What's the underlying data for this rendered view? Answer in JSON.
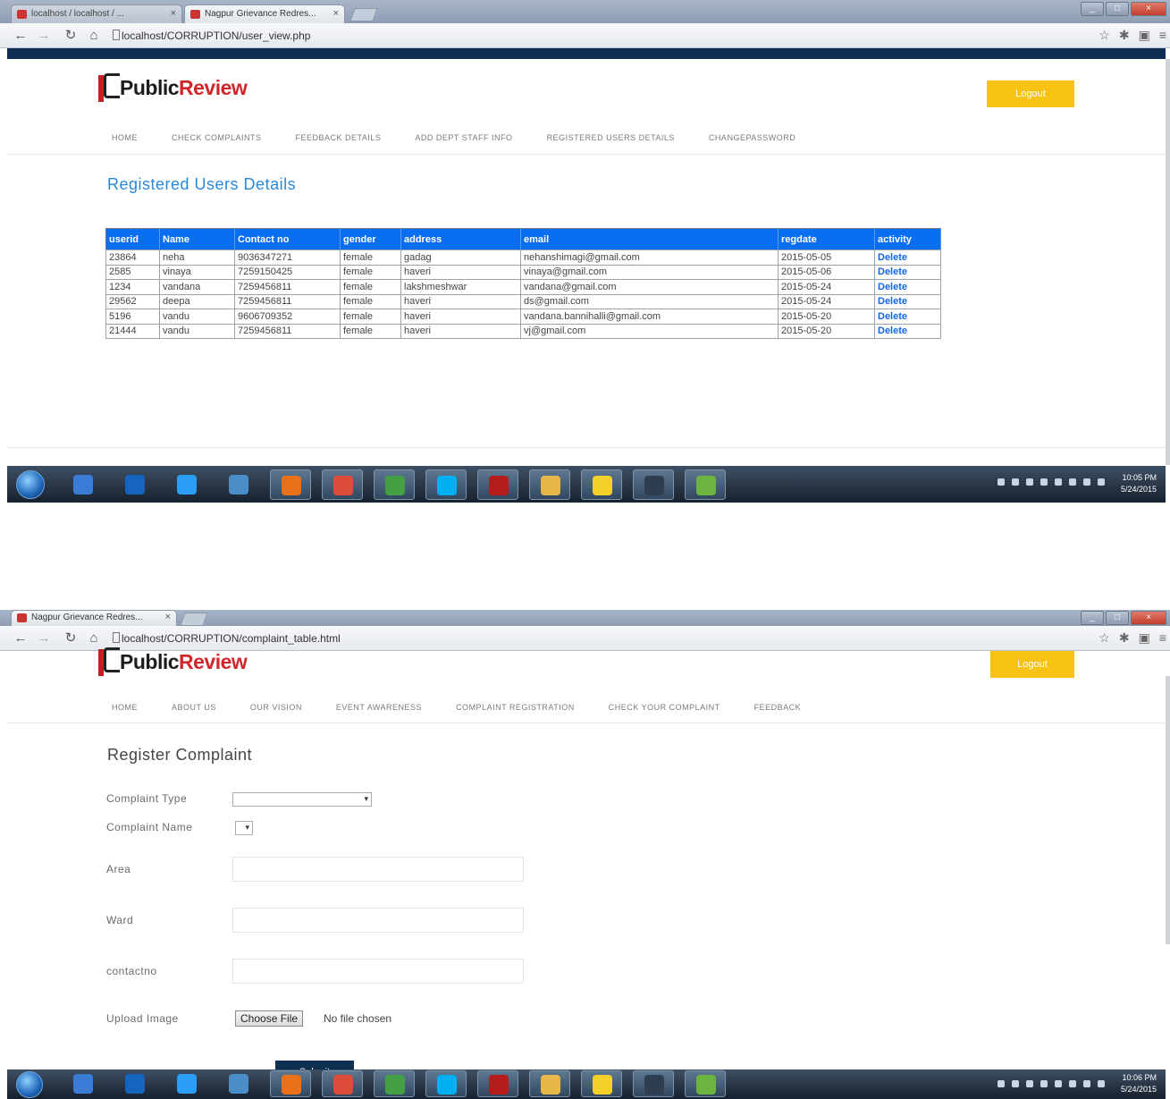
{
  "screenshot1": {
    "tabs": [
      {
        "label": "localhost / localhost / ..."
      },
      {
        "label": "Nagpur Grievance Redres..."
      }
    ],
    "url": "localhost/CORRUPTION/user_view.php",
    "logo": {
      "part1": "Public",
      "part2": "Review"
    },
    "logout_label": "Logout",
    "menu": [
      "HOME",
      "CHECK COMPLAINTS",
      "FEEDBACK DETAILS",
      "ADD DEPT STAFF INFO",
      "REGISTERED USERS DETAILS",
      "CHANGEPASSWORD"
    ],
    "heading": "Registered Users Details",
    "table": {
      "headers": [
        "userid",
        "Name",
        "Contact no",
        "gender",
        "address",
        "email",
        "regdate",
        "activity"
      ],
      "rows": [
        [
          "23864",
          "neha",
          "9036347271",
          "female",
          "gadag",
          "nehanshimagi@gmail.com",
          "2015-05-05",
          "Delete"
        ],
        [
          "2585",
          "vinaya",
          "7259150425",
          "female",
          "haveri",
          "vinaya@gmail.com",
          "2015-05-06",
          "Delete"
        ],
        [
          "1234",
          "vandana",
          "7259456811",
          "female",
          "lakshmeshwar",
          "vandana@gmail.com",
          "2015-05-24",
          "Delete"
        ],
        [
          "29562",
          "deepa",
          "7259456811",
          "female",
          "haveri",
          "ds@gmail.com",
          "2015-05-24",
          "Delete"
        ],
        [
          "5196",
          "vandu",
          "9606709352",
          "female",
          "haveri",
          "vandana.bannihalli@gmail.com",
          "2015-05-20",
          "Delete"
        ],
        [
          "21444",
          "vandu",
          "7259456811",
          "female",
          "haveri",
          "vj@gmail.com",
          "2015-05-20",
          "Delete"
        ]
      ]
    },
    "clock": {
      "time": "10:05 PM",
      "date": "5/24/2015"
    }
  },
  "screenshot2": {
    "tabs": [
      {
        "label": "Nagpur Grievance Redres..."
      }
    ],
    "url": "localhost/CORRUPTION/complaint_table.html",
    "logo": {
      "part1": "Public",
      "part2": "Review"
    },
    "logout_label": "Logout",
    "menu": [
      "HOME",
      "ABOUT US",
      "OUR VISION",
      "EVENT AWARENESS",
      "COMPLAINT REGISTRATION",
      "CHECK YOUR COMPLAINT",
      "FEEDBACK"
    ],
    "heading": "Register Complaint",
    "form": {
      "complaint_type_label": "Complaint Type",
      "complaint_type_value": "",
      "complaint_name_label": "Complaint Name",
      "complaint_name_value": "",
      "area_label": "Area",
      "ward_label": "Ward",
      "contact_label": "contactno",
      "upload_label": "Upload Image",
      "choose_file_label": "Choose File",
      "no_file_text": "No file chosen",
      "submit_label": "Submit"
    },
    "clock": {
      "time": "10:06 PM",
      "date": "5/24/2015"
    }
  },
  "taskbar_icons": [
    "explorer-icon",
    "media-player-icon",
    "internet-explorer-icon",
    "library-icon",
    "firefox-icon",
    "chrome-icon",
    "torrent-icon",
    "skype-icon",
    "acrobat-icon",
    "folder-icon",
    "app-icon",
    "calculator-icon",
    "dreamweaver-icon"
  ]
}
